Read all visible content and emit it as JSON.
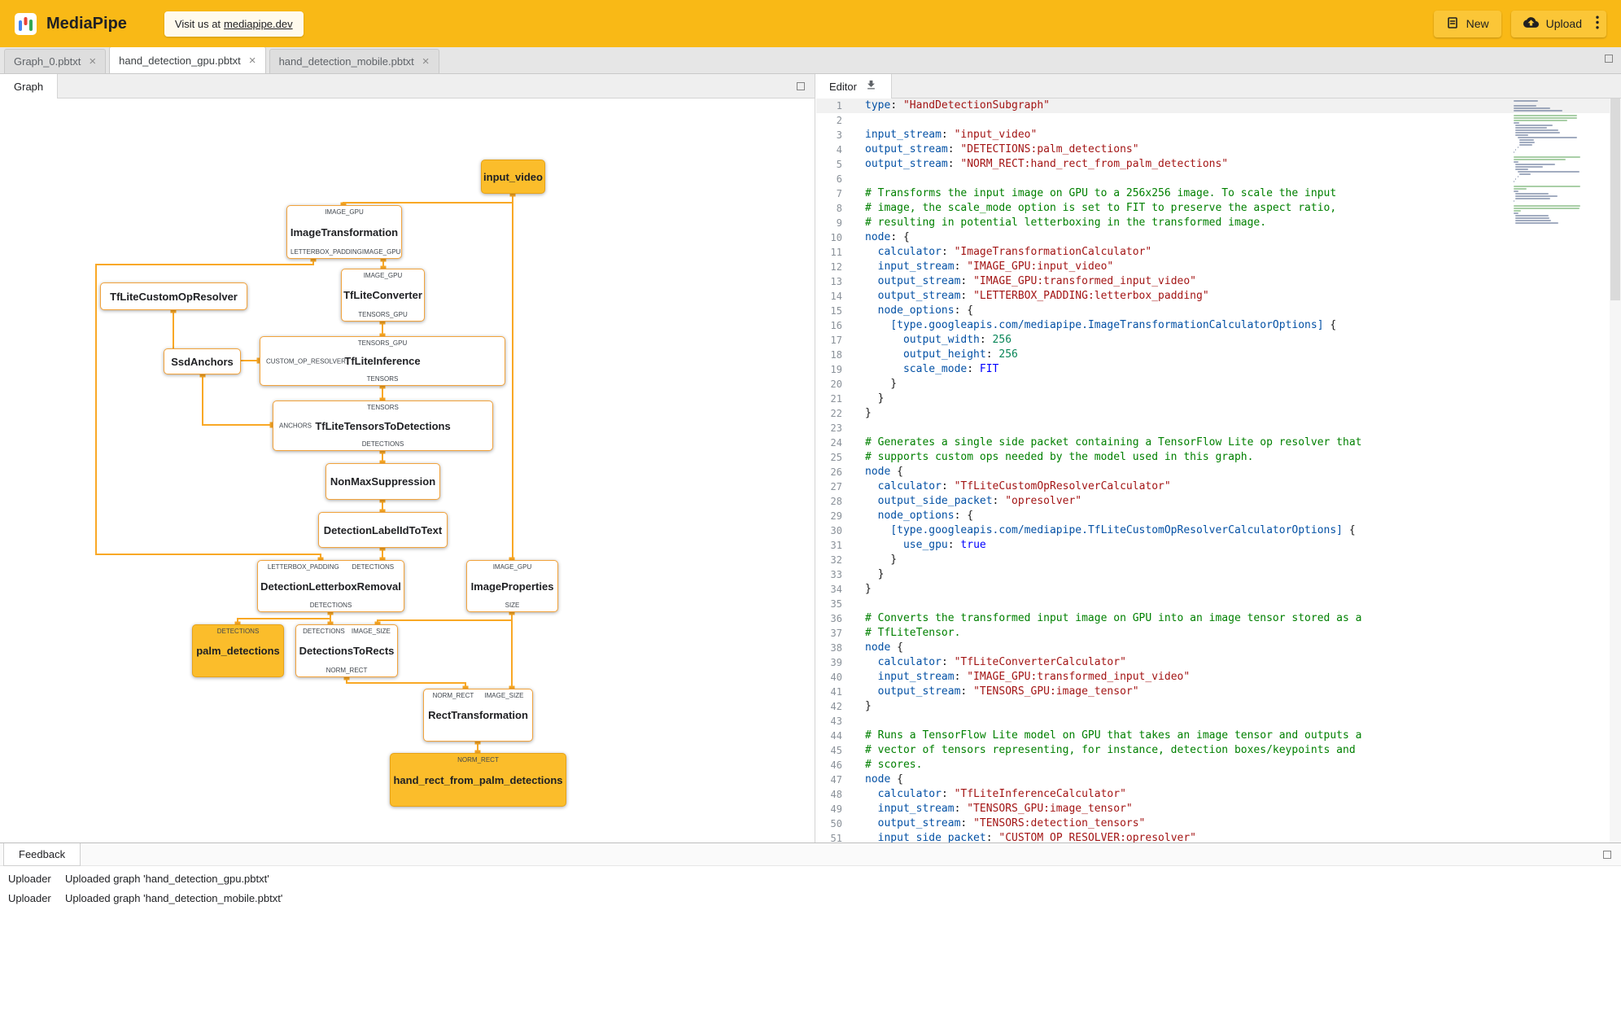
{
  "colors": {
    "brand_yellow": "#F9B916",
    "button_yellow": "#FBC637",
    "edge_orange": "#F9A825",
    "io_node_fill": "#FBBD2B",
    "comment_green": "#008000",
    "string_red": "#A31515"
  },
  "header": {
    "app_name": "MediaPipe",
    "visit_prefix": "Visit us at",
    "visit_link": "mediapipe.dev",
    "new_button": "New",
    "upload_button": "Upload"
  },
  "close_glyph": "×",
  "file_tabs": [
    {
      "label": "Graph_0.pbtxt",
      "active": false
    },
    {
      "label": "hand_detection_gpu.pbtxt",
      "active": true
    },
    {
      "label": "hand_detection_mobile.pbtxt",
      "active": false
    }
  ],
  "panels": {
    "graph_tab": "Graph",
    "editor_tab": "Editor",
    "feedback_tab": "Feedback"
  },
  "graph": {
    "nodes": {
      "input_video": {
        "label": "input_video"
      },
      "image_transformation": {
        "label": "ImageTransformation",
        "top_ports": [
          "IMAGE_GPU"
        ],
        "bottom_ports": [
          "LETTERBOX_PADDING",
          "IMAGE_GPU"
        ]
      },
      "tflite_converter": {
        "label": "TfLiteConverter",
        "top_ports": [
          "IMAGE_GPU"
        ],
        "bottom_ports": [
          "TENSORS_GPU"
        ]
      },
      "tflite_custom_op_resolver": {
        "label": "TfLiteCustomOpResolver"
      },
      "ssd_anchors": {
        "label": "SsdAnchors"
      },
      "tflite_inference": {
        "label": "TfLiteInference",
        "top_ports": [
          "TENSORS_GPU"
        ],
        "left_ports": [
          "CUSTOM_OP_RESOLVER"
        ],
        "bottom_ports": [
          "TENSORS"
        ]
      },
      "tflite_tensors_to_detections": {
        "label": "TfLiteTensorsToDetections",
        "top_ports": [
          "TENSORS"
        ],
        "left_ports": [
          "ANCHORS"
        ],
        "bottom_ports": [
          "DETECTIONS"
        ]
      },
      "non_max_suppression": {
        "label": "NonMaxSuppression"
      },
      "detection_label_id_to_text": {
        "label": "DetectionLabelIdToText"
      },
      "detection_letterbox_removal": {
        "label": "DetectionLetterboxRemoval",
        "top_ports": [
          "LETTERBOX_PADDING",
          "DETECTIONS"
        ],
        "bottom_ports": [
          "DETECTIONS"
        ]
      },
      "image_properties": {
        "label": "ImageProperties",
        "top_ports": [
          "IMAGE_GPU"
        ],
        "bottom_ports": [
          "SIZE"
        ]
      },
      "palm_detections": {
        "label": "palm_detections",
        "top_ports": [
          "DETECTIONS"
        ]
      },
      "detections_to_rects": {
        "label": "DetectionsToRects",
        "top_ports": [
          "DETECTIONS",
          "IMAGE_SIZE"
        ],
        "bottom_ports": [
          "NORM_RECT"
        ]
      },
      "rect_transformation": {
        "label": "RectTransformation",
        "top_ports": [
          "NORM_RECT",
          "IMAGE_SIZE"
        ]
      },
      "hand_rect": {
        "label": "hand_rect_from_palm_detections",
        "top_ports": [
          "NORM_RECT"
        ]
      }
    }
  },
  "editor": {
    "lines": [
      "type: \"HandDetectionSubgraph\"",
      "",
      "input_stream: \"input_video\"",
      "output_stream: \"DETECTIONS:palm_detections\"",
      "output_stream: \"NORM_RECT:hand_rect_from_palm_detections\"",
      "",
      "# Transforms the input image on GPU to a 256x256 image. To scale the input",
      "# image, the scale_mode option is set to FIT to preserve the aspect ratio,",
      "# resulting in potential letterboxing in the transformed image.",
      "node: {",
      "  calculator: \"ImageTransformationCalculator\"",
      "  input_stream: \"IMAGE_GPU:input_video\"",
      "  output_stream: \"IMAGE_GPU:transformed_input_video\"",
      "  output_stream: \"LETTERBOX_PADDING:letterbox_padding\"",
      "  node_options: {",
      "    [type.googleapis.com/mediapipe.ImageTransformationCalculatorOptions] {",
      "      output_width: 256",
      "      output_height: 256",
      "      scale_mode: FIT",
      "    }",
      "  }",
      "}",
      "",
      "# Generates a single side packet containing a TensorFlow Lite op resolver that",
      "# supports custom ops needed by the model used in this graph.",
      "node {",
      "  calculator: \"TfLiteCustomOpResolverCalculator\"",
      "  output_side_packet: \"opresolver\"",
      "  node_options: {",
      "    [type.googleapis.com/mediapipe.TfLiteCustomOpResolverCalculatorOptions] {",
      "      use_gpu: true",
      "    }",
      "  }",
      "}",
      "",
      "# Converts the transformed input image on GPU into an image tensor stored as a",
      "# TfLiteTensor.",
      "node {",
      "  calculator: \"TfLiteConverterCalculator\"",
      "  input_stream: \"IMAGE_GPU:transformed_input_video\"",
      "  output_stream: \"TENSORS_GPU:image_tensor\"",
      "}",
      "",
      "# Runs a TensorFlow Lite model on GPU that takes an image tensor and outputs a",
      "# vector of tensors representing, for instance, detection boxes/keypoints and",
      "# scores.",
      "node {",
      "  calculator: \"TfLiteInferenceCalculator\"",
      "  input_stream: \"TENSORS_GPU:image_tensor\"",
      "  output_stream: \"TENSORS:detection_tensors\"",
      "  input_side_packet: \"CUSTOM_OP_RESOLVER:opresolver\""
    ]
  },
  "feedback": {
    "entries": [
      {
        "source": "Uploader",
        "message": "Uploaded graph 'hand_detection_gpu.pbtxt'"
      },
      {
        "source": "Uploader",
        "message": "Uploaded graph 'hand_detection_mobile.pbtxt'"
      }
    ]
  }
}
